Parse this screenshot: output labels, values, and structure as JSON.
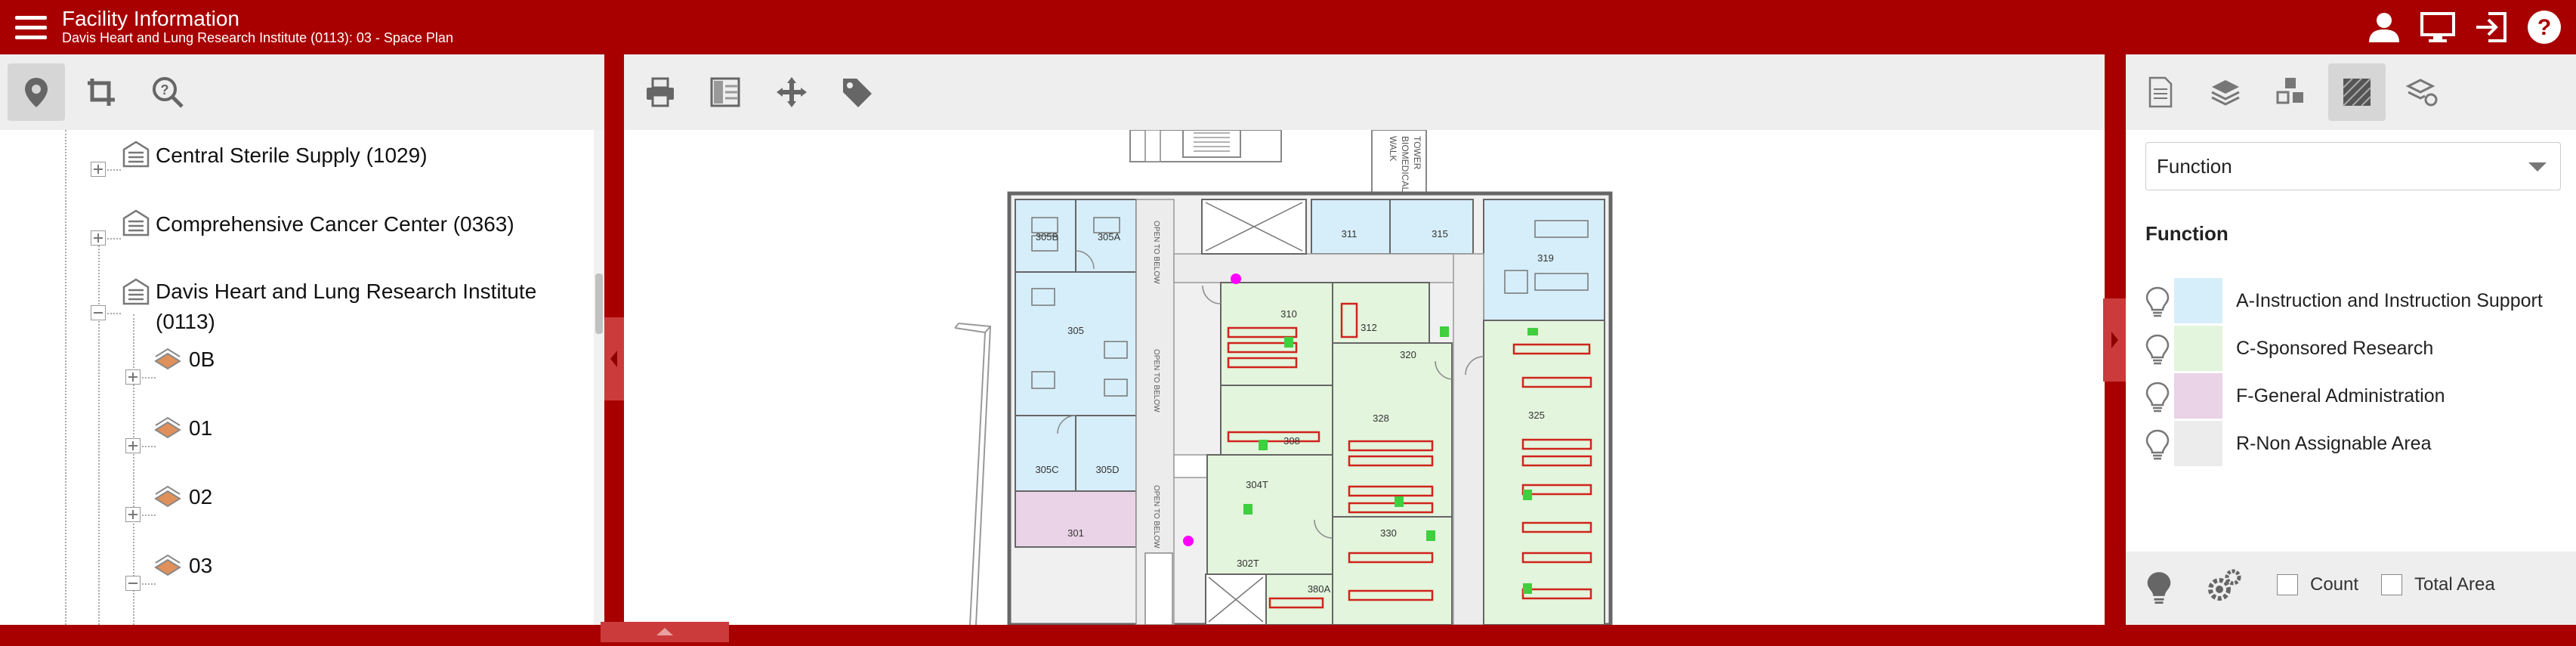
{
  "header": {
    "title": "Facility Information",
    "subtitle": "Davis Heart and Lung Research Institute (0113): 03 - Space Plan",
    "icons": [
      "user-icon",
      "monitor-icon",
      "logout-icon",
      "help-icon"
    ]
  },
  "left_toolbar": {
    "buttons": [
      "location-pin-icon",
      "crop-icon",
      "query-search-icon"
    ],
    "active": "location-pin-icon"
  },
  "tree": {
    "nodes": [
      {
        "label": "Central Sterile Supply (1029)"
      },
      {
        "label": "Comprehensive Cancer Center (0363)"
      },
      {
        "label_line1": "Davis Heart and Lung Research Institute",
        "label_line2": "(0113)"
      },
      {
        "label": "0B"
      },
      {
        "label": "01"
      },
      {
        "label": "02"
      },
      {
        "label": "03"
      }
    ]
  },
  "center_toolbar": {
    "buttons": [
      "print-icon",
      "panel-layout-icon",
      "pan-move-icon",
      "tag-icon"
    ]
  },
  "map": {
    "rooms": [
      "305B",
      "305A",
      "311",
      "315",
      "319",
      "310",
      "312",
      "320",
      "305",
      "325",
      "328",
      "308",
      "305C",
      "305D",
      "304T",
      "330",
      "301",
      "302T",
      "380A"
    ],
    "stair_labels": [
      "WALK",
      "BIOMEDICAL",
      "TOWER"
    ],
    "corridor_labels": [
      "OPEN TO BELOW",
      "OPEN TO BELOW",
      "OPEN TO BELOW"
    ],
    "marker_color": "#ff00ff"
  },
  "right_toolbar": {
    "buttons": [
      "document-icon",
      "layers-icon",
      "cubes-icon",
      "hatch-fill-icon",
      "layer-settings-icon"
    ],
    "active": "hatch-fill-icon"
  },
  "right_panel": {
    "select_value": "Function",
    "legend_title": "Function",
    "legend": [
      {
        "label": "A-Instruction and Instruction Support",
        "color": "#d6eef9"
      },
      {
        "label": "C-Sponsored Research",
        "color": "#e3f5dc"
      },
      {
        "label": "F-General Administration",
        "color": "#ead3e6"
      },
      {
        "label": "R-Non Assignable Area",
        "color": "#ececec"
      }
    ],
    "footer": {
      "count_label": "Count",
      "total_area_label": "Total Area",
      "icons": [
        "lightbulb-icon",
        "gears-icon"
      ]
    }
  },
  "colors": {
    "brand": "#a80000",
    "toolbar": "#eeeeee",
    "instruction": "#d6eef9",
    "research": "#e3f5dc",
    "admin": "#ead3e6",
    "non_assignable": "#ececec"
  }
}
